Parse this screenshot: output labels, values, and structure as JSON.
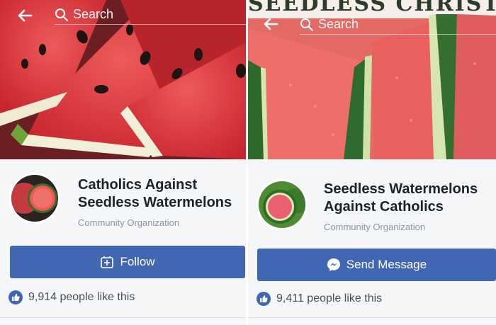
{
  "left": {
    "search_placeholder": "Search",
    "page_name_line1": "Catholics Against",
    "page_name_line2": "Seedless Watermelons",
    "category": "Community Organization",
    "action_label": "Follow",
    "likes_text": "9,914 people like this"
  },
  "right": {
    "cover_banner_text": "SEEDLESS CHRIST",
    "search_placeholder": "Search",
    "page_name_line1": "Seedless Watermelons",
    "page_name_line2": "Against Catholics",
    "category": "Community Organization",
    "action_label": "Send Message",
    "likes_text": "9,411 people like this"
  },
  "colors": {
    "button_blue": "#4267b2",
    "watermelon_red": "#e2474a",
    "rind_green": "#3f7a3a"
  },
  "icons": [
    "back-arrow-icon",
    "search-icon",
    "follow-icon",
    "messenger-icon",
    "like-icon"
  ]
}
